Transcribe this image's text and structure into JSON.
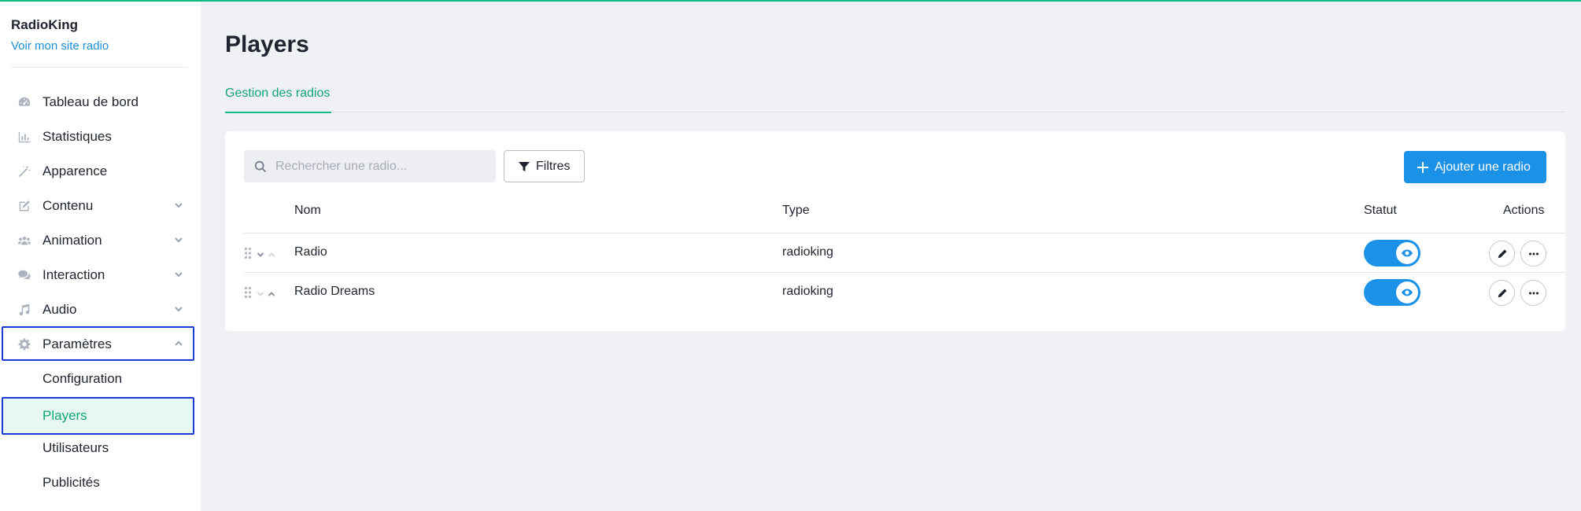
{
  "brand": {
    "name": "RadioKing",
    "link": "Voir mon site radio"
  },
  "sidebar": {
    "items": [
      {
        "label": "Tableau de bord",
        "icon": "dashboard-icon"
      },
      {
        "label": "Statistiques",
        "icon": "chart-icon"
      },
      {
        "label": "Apparence",
        "icon": "magic-wand-icon"
      },
      {
        "label": "Contenu",
        "icon": "edit-icon",
        "chevron": "down"
      },
      {
        "label": "Animation",
        "icon": "users-icon",
        "chevron": "down"
      },
      {
        "label": "Interaction",
        "icon": "comments-icon",
        "chevron": "down"
      },
      {
        "label": "Audio",
        "icon": "music-icon",
        "chevron": "down"
      },
      {
        "label": "Paramètres",
        "icon": "gear-icon",
        "chevron": "up"
      }
    ],
    "sub_items": [
      {
        "label": "Configuration"
      },
      {
        "label": "Players",
        "active": true
      },
      {
        "label": "Utilisateurs"
      },
      {
        "label": "Publicités"
      }
    ]
  },
  "page": {
    "title": "Players",
    "tab": "Gestion des radios"
  },
  "toolbar": {
    "search_placeholder": "Rechercher une radio...",
    "filter_label": "Filtres",
    "add_label": "Ajouter une radio"
  },
  "table": {
    "headers": {
      "name": "Nom",
      "type": "Type",
      "status": "Statut",
      "actions": "Actions"
    },
    "rows": [
      {
        "name": "Radio",
        "type": "radioking",
        "status_on": true
      },
      {
        "name": "Radio Dreams",
        "type": "radioking",
        "status_on": true
      }
    ]
  },
  "colors": {
    "accent_green": "#12b886",
    "primary_blue": "#1c91e8",
    "highlight_border": "#1b3ad6"
  }
}
